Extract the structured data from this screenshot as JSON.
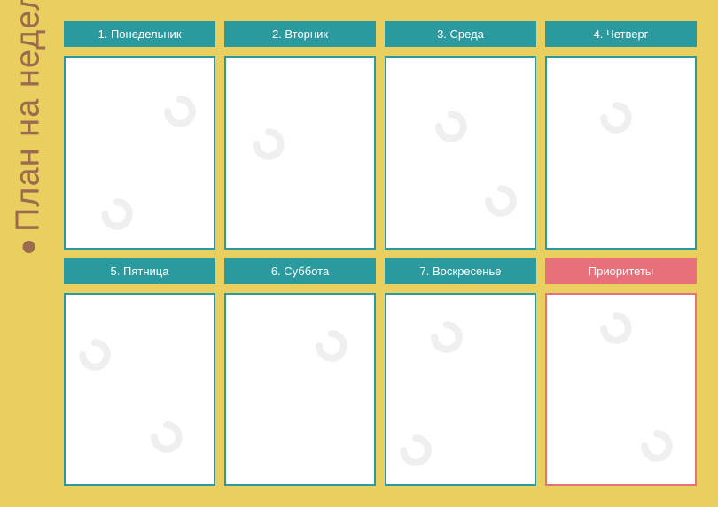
{
  "title": "План на неделю",
  "days": [
    {
      "label": "1. Понедельник"
    },
    {
      "label": "2. Вторник"
    },
    {
      "label": "3. Среда"
    },
    {
      "label": "4. Четверг"
    },
    {
      "label": "5. Пятница"
    },
    {
      "label": "6. Суббота"
    },
    {
      "label": "7. Воскресенье"
    }
  ],
  "priorities_label": "Приоритеты",
  "colors": {
    "background": "#e9cf5f",
    "teal": "#2a9a9e",
    "pink": "#e8707b",
    "brown": "#9c6a4e"
  }
}
